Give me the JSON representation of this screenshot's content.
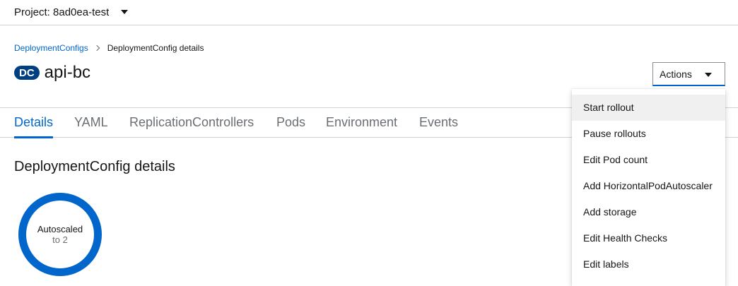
{
  "project": {
    "label": "Project: 8ad0ea-test"
  },
  "breadcrumb": {
    "parent": "DeploymentConfigs",
    "current": "DeploymentConfig details"
  },
  "header": {
    "badge": "DC",
    "title": "api-bc",
    "actions_label": "Actions"
  },
  "tabs": [
    {
      "label": "Details",
      "active": true
    },
    {
      "label": "YAML"
    },
    {
      "label": "ReplicationControllers"
    },
    {
      "label": "Pods"
    },
    {
      "label": "Environment"
    },
    {
      "label": "Events"
    }
  ],
  "details": {
    "heading": "DeploymentConfig details",
    "donut_line1": "Autoscaled",
    "donut_line2": "to 2"
  },
  "actions_menu": [
    {
      "label": "Start rollout",
      "hovered": true
    },
    {
      "label": "Pause rollouts"
    },
    {
      "label": "Edit Pod count"
    },
    {
      "label": "Add HorizontalPodAutoscaler"
    },
    {
      "label": "Add storage"
    },
    {
      "label": "Edit Health Checks"
    },
    {
      "label": "Edit labels"
    }
  ],
  "colors": {
    "accent": "#0066cc",
    "badge": "#004080",
    "hover": "#f0f0f0"
  }
}
